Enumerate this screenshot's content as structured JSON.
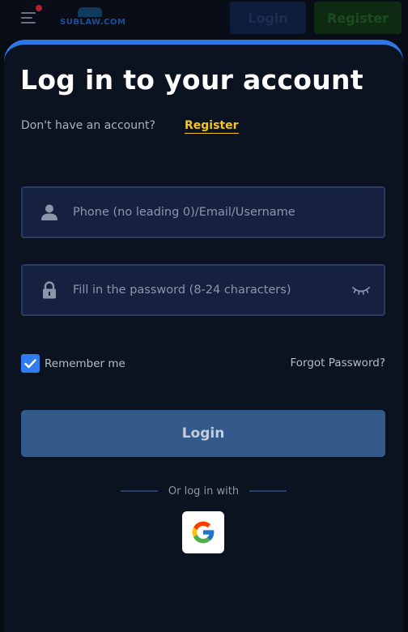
{
  "header": {
    "logo_text": "SUBLAW.COM",
    "login_label": "Login",
    "register_label": "Register"
  },
  "modal": {
    "title": "Log in to your account",
    "account_prompt": "Don't have an account?",
    "register_link": "Register",
    "username_field": {
      "placeholder": "Phone (no leading 0)/Email/Username",
      "value": "",
      "icon": "user-icon"
    },
    "password_field": {
      "placeholder": "Fill in the password (8-24 characters)",
      "value": "",
      "icon": "lock-icon",
      "toggle_icon": "eye-closed-icon"
    },
    "remember_label": "Remember me",
    "remember_checked": true,
    "forgot_label": "Forgot Password?",
    "login_button": "Login",
    "divider_text": "Or log in with",
    "social": [
      {
        "provider": "google",
        "icon": "google-icon"
      }
    ]
  },
  "colors": {
    "accent": "#2e78e6",
    "link": "#f5c518",
    "background": "#0b1220",
    "field": "#16213f",
    "button": "#345a8c"
  }
}
